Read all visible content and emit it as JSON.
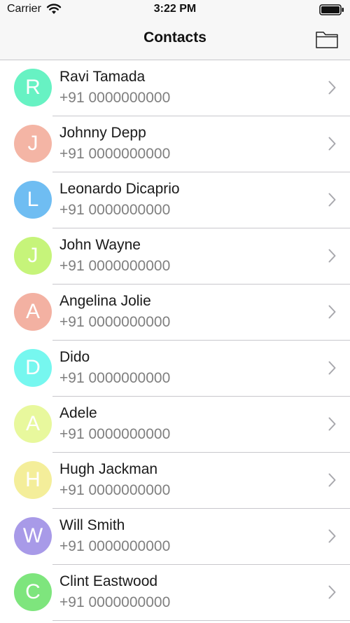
{
  "status_bar": {
    "carrier": "Carrier",
    "time": "3:22 PM",
    "wifi_icon": "wifi-icon",
    "battery_icon": "battery-icon"
  },
  "nav": {
    "title": "Contacts",
    "folder_icon": "folder-icon"
  },
  "contacts": [
    {
      "initial": "R",
      "name": "Ravi Tamada",
      "phone": "+91 0000000000",
      "color": "#67f2c3"
    },
    {
      "initial": "J",
      "name": "Johnny Depp",
      "phone": "+91 0000000000",
      "color": "#f4b5a5"
    },
    {
      "initial": "L",
      "name": "Leonardo Dicaprio",
      "phone": "+91 0000000000",
      "color": "#6fbdf2"
    },
    {
      "initial": "J",
      "name": "John Wayne",
      "phone": "+91 0000000000",
      "color": "#c6f47a"
    },
    {
      "initial": "A",
      "name": "Angelina Jolie",
      "phone": "+91 0000000000",
      "color": "#f3b1a2"
    },
    {
      "initial": "D",
      "name": "Dido",
      "phone": "+91 0000000000",
      "color": "#76f7ef"
    },
    {
      "initial": "A",
      "name": "Adele",
      "phone": "+91 0000000000",
      "color": "#e8f89d"
    },
    {
      "initial": "H",
      "name": "Hugh Jackman",
      "phone": "+91 0000000000",
      "color": "#f4ee9a"
    },
    {
      "initial": "W",
      "name": "Will Smith",
      "phone": "+91 0000000000",
      "color": "#a89ae8"
    },
    {
      "initial": "C",
      "name": "Clint Eastwood",
      "phone": "+91 0000000000",
      "color": "#7ee57d"
    }
  ],
  "row_chevron_icon": "chevron-right-icon"
}
